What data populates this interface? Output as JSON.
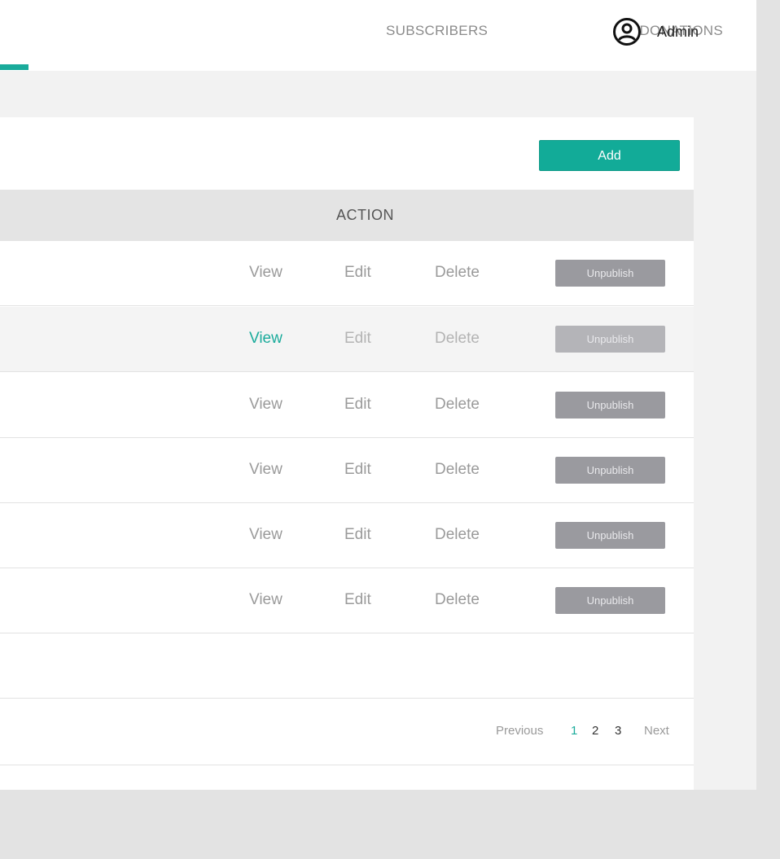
{
  "nav": {
    "donations_label": "DONATIONS",
    "subscribers_label": "SUBSCRIBERS",
    "user_name": "Admin",
    "user_icon": "user-circle-icon"
  },
  "toolbar": {
    "add_label": "Add"
  },
  "table": {
    "header_action": "ACTION",
    "rows": [
      {
        "view": "View",
        "edit": "Edit",
        "delete": "Delete",
        "unpublish": "Unpublish"
      },
      {
        "view": "View",
        "edit": "Edit",
        "delete": "Delete",
        "unpublish": "Unpublish"
      },
      {
        "view": "View",
        "edit": "Edit",
        "delete": "Delete",
        "unpublish": "Unpublish"
      },
      {
        "view": "View",
        "edit": "Edit",
        "delete": "Delete",
        "unpublish": "Unpublish"
      },
      {
        "view": "View",
        "edit": "Edit",
        "delete": "Delete",
        "unpublish": "Unpublish"
      },
      {
        "view": "View",
        "edit": "Edit",
        "delete": "Delete",
        "unpublish": "Unpublish"
      }
    ]
  },
  "pagination": {
    "previous": "Previous",
    "pages": [
      "1",
      "2",
      "3"
    ],
    "next": "Next",
    "current": "1"
  },
  "colors": {
    "accent": "#1aab9b",
    "button_grey": "#9a9a9f"
  }
}
